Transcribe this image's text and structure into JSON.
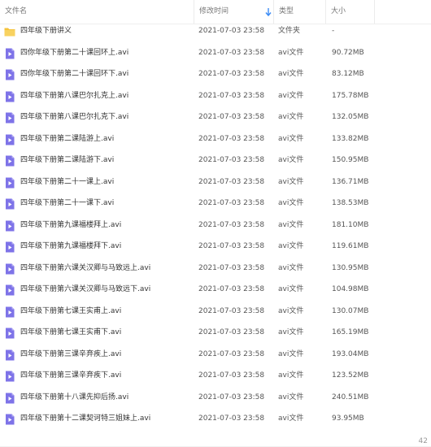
{
  "columns": {
    "name": "文件名",
    "time": "修改时间",
    "type": "类型",
    "size": "大小"
  },
  "colors": {
    "folder": "#f5c33b",
    "video": "#7e73e8"
  },
  "files": [
    {
      "name": "四年级下册讲义",
      "time": "2021-07-03 23:58",
      "type": "文件夹",
      "size": "-",
      "icon": "folder-icon"
    },
    {
      "name": "四你年级下册第二十课回环上.avi",
      "time": "2021-07-03 23:58",
      "type": "avi文件",
      "size": "90.72MB",
      "icon": "video-file-icon"
    },
    {
      "name": "四你年级下册第二十课回环下.avi",
      "time": "2021-07-03 23:58",
      "type": "avi文件",
      "size": "83.12MB",
      "icon": "video-file-icon"
    },
    {
      "name": "四年级下册第八课巴尔扎克上.avi",
      "time": "2021-07-03 23:58",
      "type": "avi文件",
      "size": "175.78MB",
      "icon": "video-file-icon"
    },
    {
      "name": "四年级下册第八课巴尔扎克下.avi",
      "time": "2021-07-03 23:58",
      "type": "avi文件",
      "size": "132.05MB",
      "icon": "video-file-icon"
    },
    {
      "name": "四年级下册第二课陆游上.avi",
      "time": "2021-07-03 23:58",
      "type": "avi文件",
      "size": "133.82MB",
      "icon": "video-file-icon"
    },
    {
      "name": "四年级下册第二课陆游下.avi",
      "time": "2021-07-03 23:58",
      "type": "avi文件",
      "size": "150.95MB",
      "icon": "video-file-icon"
    },
    {
      "name": "四年级下册第二十一课上.avi",
      "time": "2021-07-03 23:58",
      "type": "avi文件",
      "size": "136.71MB",
      "icon": "video-file-icon"
    },
    {
      "name": "四年级下册第二十一课下.avi",
      "time": "2021-07-03 23:58",
      "type": "avi文件",
      "size": "138.53MB",
      "icon": "video-file-icon"
    },
    {
      "name": "四年级下册第九课福楼拜上.avi",
      "time": "2021-07-03 23:58",
      "type": "avi文件",
      "size": "181.10MB",
      "icon": "video-file-icon"
    },
    {
      "name": "四年级下册第九课福楼拜下.avi",
      "time": "2021-07-03 23:58",
      "type": "avi文件",
      "size": "119.61MB",
      "icon": "video-file-icon"
    },
    {
      "name": "四年级下册第六课关汉卿与马致远上.avi",
      "time": "2021-07-03 23:58",
      "type": "avi文件",
      "size": "130.95MB",
      "icon": "video-file-icon"
    },
    {
      "name": "四年级下册第六课关汉卿与马致远下.avi",
      "time": "2021-07-03 23:58",
      "type": "avi文件",
      "size": "104.98MB",
      "icon": "video-file-icon"
    },
    {
      "name": "四年级下册第七课王实甫上.avi",
      "time": "2021-07-03 23:58",
      "type": "avi文件",
      "size": "130.07MB",
      "icon": "video-file-icon"
    },
    {
      "name": "四年级下册第七课王实甫下.avi",
      "time": "2021-07-03 23:58",
      "type": "avi文件",
      "size": "165.19MB",
      "icon": "video-file-icon"
    },
    {
      "name": "四年级下册第三课辛弃疾上.avi",
      "time": "2021-07-03 23:58",
      "type": "avi文件",
      "size": "193.04MB",
      "icon": "video-file-icon"
    },
    {
      "name": "四年级下册第三课辛弃疾下.avi",
      "time": "2021-07-03 23:58",
      "type": "avi文件",
      "size": "123.52MB",
      "icon": "video-file-icon"
    },
    {
      "name": "四年级下册第十八课先抑后扬.avi",
      "time": "2021-07-03 23:58",
      "type": "avi文件",
      "size": "240.51MB",
      "icon": "video-file-icon"
    },
    {
      "name": "四年级下册第十二课契诃特三姐妹上.avi",
      "time": "2021-07-03 23:58",
      "type": "avi文件",
      "size": "93.95MB",
      "icon": "video-file-icon"
    }
  ],
  "footer": {
    "count": "42"
  }
}
